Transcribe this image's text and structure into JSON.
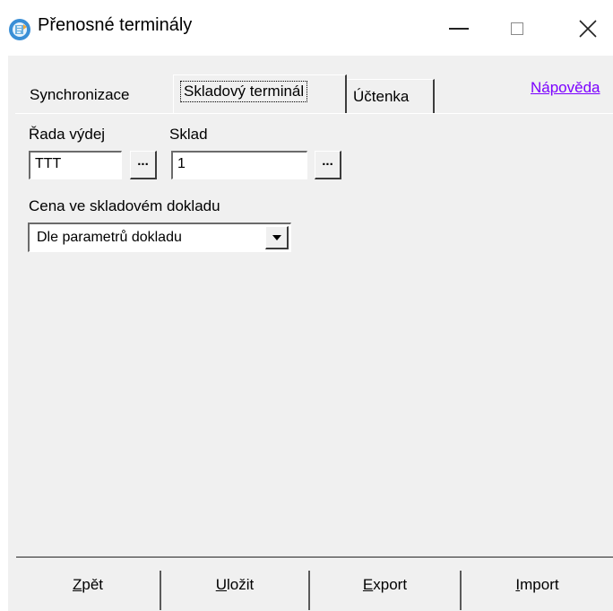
{
  "window": {
    "title": "Přenosné terminály",
    "icon": "app-icon",
    "controls": {
      "minimize": "minimize-icon",
      "maximize": "maximize-icon",
      "close": "close-icon"
    }
  },
  "tabs": [
    {
      "label": "Synchronizace",
      "active": false
    },
    {
      "label": "Skladový terminál",
      "active": true
    },
    {
      "label": "Účtenka",
      "active": false
    }
  ],
  "help_link": "Nápověda",
  "form": {
    "rada_label": "Řada výdej",
    "rada_value": "TTT",
    "rada_browse": "...",
    "sklad_label": "Sklad",
    "sklad_value": "1",
    "sklad_browse": "...",
    "price_label": "Cena ve skladovém dokladu",
    "price_value": "Dle parametrů dokladu"
  },
  "buttons": {
    "back": {
      "accel": "Z",
      "rest": "pět"
    },
    "save": {
      "accel": "U",
      "rest": "ložit"
    },
    "export": {
      "accel": "E",
      "rest": "xport"
    },
    "import": {
      "accel": "I",
      "rest": "mport"
    }
  },
  "colors": {
    "background": "#f0f0f0",
    "link": "#7b00ff",
    "titlebar": "#ffffff"
  }
}
